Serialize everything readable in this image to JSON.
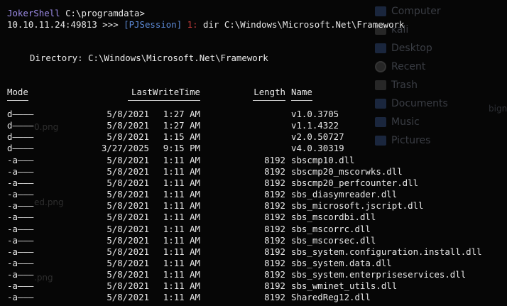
{
  "prompt": {
    "user": "JokerShell",
    "path": "C:\\programdata>",
    "address": "10.10.11.24:49813 >>>",
    "session": "[PJSession]",
    "session_index": "1:",
    "command": "dir C:\\Windows\\Microsoft.Net\\Framework"
  },
  "directory_line": "Directory: C:\\Windows\\Microsoft.Net\\Framework",
  "columns": {
    "mode": "Mode",
    "lastwritetime": "LastWriteTime",
    "length": "Length",
    "name": "Name"
  },
  "entries": [
    {
      "mode": "d————",
      "date": "5/8/2021",
      "time": "1:27 AM",
      "length": "",
      "name": "v1.0.3705"
    },
    {
      "mode": "d————",
      "date": "5/8/2021",
      "time": "1:27 AM",
      "length": "",
      "name": "v1.1.4322"
    },
    {
      "mode": "d————",
      "date": "5/8/2021",
      "time": "1:15 AM",
      "length": "",
      "name": "v2.0.50727"
    },
    {
      "mode": "d————",
      "date": "3/27/2025",
      "time": "9:15 PM",
      "length": "",
      "name": "v4.0.30319"
    },
    {
      "mode": "-a———",
      "date": "5/8/2021",
      "time": "1:11 AM",
      "length": "8192",
      "name": "sbscmp10.dll"
    },
    {
      "mode": "-a———",
      "date": "5/8/2021",
      "time": "1:11 AM",
      "length": "8192",
      "name": "sbscmp20_mscorwks.dll"
    },
    {
      "mode": "-a———",
      "date": "5/8/2021",
      "time": "1:11 AM",
      "length": "8192",
      "name": "sbscmp20_perfcounter.dll"
    },
    {
      "mode": "-a———",
      "date": "5/8/2021",
      "time": "1:11 AM",
      "length": "8192",
      "name": "sbs_diasymreader.dll"
    },
    {
      "mode": "-a———",
      "date": "5/8/2021",
      "time": "1:11 AM",
      "length": "8192",
      "name": "sbs_microsoft.jscript.dll"
    },
    {
      "mode": "-a———",
      "date": "5/8/2021",
      "time": "1:11 AM",
      "length": "8192",
      "name": "sbs_mscordbi.dll"
    },
    {
      "mode": "-a———",
      "date": "5/8/2021",
      "time": "1:11 AM",
      "length": "8192",
      "name": "sbs_mscorrc.dll"
    },
    {
      "mode": "-a———",
      "date": "5/8/2021",
      "time": "1:11 AM",
      "length": "8192",
      "name": "sbs_mscorsec.dll"
    },
    {
      "mode": "-a———",
      "date": "5/8/2021",
      "time": "1:11 AM",
      "length": "8192",
      "name": "sbs_system.configuration.install.dll"
    },
    {
      "mode": "-a———",
      "date": "5/8/2021",
      "time": "1:11 AM",
      "length": "8192",
      "name": "sbs_system.data.dll"
    },
    {
      "mode": "-a———",
      "date": "5/8/2021",
      "time": "1:11 AM",
      "length": "8192",
      "name": "sbs_system.enterpriseservices.dll"
    },
    {
      "mode": "-a———",
      "date": "5/8/2021",
      "time": "1:11 AM",
      "length": "8192",
      "name": "sbs_wminet_utils.dll"
    },
    {
      "mode": "-a———",
      "date": "5/8/2021",
      "time": "1:11 AM",
      "length": "8192",
      "name": "SharedReg12.dll"
    }
  ],
  "background_sidebar": [
    {
      "label": "Computer",
      "icon": "monitor-icon"
    },
    {
      "label": "kali",
      "icon": "home-folder-icon"
    },
    {
      "label": "Desktop",
      "icon": "desktop-folder-icon"
    },
    {
      "label": "Recent",
      "icon": "clock-icon"
    },
    {
      "label": "Trash",
      "icon": "trash-icon"
    },
    {
      "label": "Documents",
      "icon": "documents-folder-icon"
    },
    {
      "label": "Music",
      "icon": "music-folder-icon"
    },
    {
      "label": "Pictures",
      "icon": "pictures-folder-icon"
    }
  ],
  "background_side_text": "bign",
  "background_files": [
    "0.png",
    "ed.png",
    ".png"
  ],
  "colors": {
    "background": "#060606",
    "text": "#e8e8e8",
    "prompt_user": "#9d8ce8",
    "session": "#5d8bd8",
    "session_index": "#c03a3a"
  }
}
